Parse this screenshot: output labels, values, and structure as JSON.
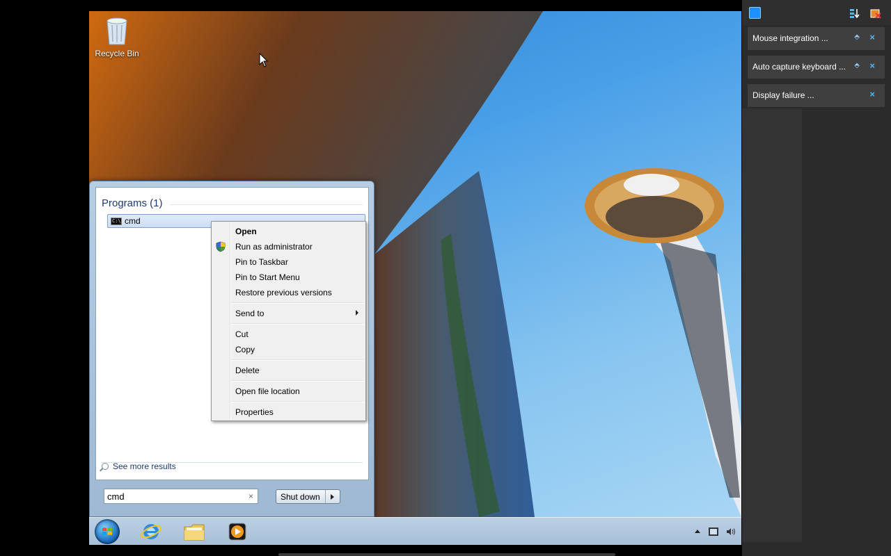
{
  "desktop": {
    "icons": [
      {
        "label": "Recycle Bin"
      }
    ]
  },
  "start_menu": {
    "section_heading": "Programs (1)",
    "results": [
      {
        "label": "cmd"
      }
    ],
    "see_more": "See more results",
    "search": {
      "value": "cmd",
      "clear_glyph": "×"
    },
    "shutdown_label": "Shut down"
  },
  "context_menu": {
    "items": [
      {
        "label": "Open",
        "default": true
      },
      {
        "label": "Run as administrator",
        "icon": "uac-shield-icon"
      },
      {
        "label": "Pin to Taskbar"
      },
      {
        "label": "Pin to Start Menu"
      },
      {
        "label": "Restore previous versions"
      },
      {
        "label": "Send to",
        "submenu": true
      },
      {
        "label": "Cut"
      },
      {
        "label": "Copy"
      },
      {
        "label": "Delete"
      },
      {
        "label": "Open file location"
      },
      {
        "label": "Properties"
      }
    ]
  },
  "taskbar": {
    "pinned": [
      "internet-explorer-icon",
      "windows-explorer-icon",
      "media-player-icon"
    ],
    "tray": [
      "show-hidden-icons",
      "network-icon",
      "volume-icon"
    ]
  },
  "side_panel": {
    "notifications": [
      {
        "title": "Mouse integration ...",
        "pinnable": true
      },
      {
        "title": "Auto capture keyboard ...",
        "pinnable": true
      },
      {
        "title": "Display failure ...",
        "pinnable": false
      }
    ],
    "accent_color": "#1e90ff"
  }
}
